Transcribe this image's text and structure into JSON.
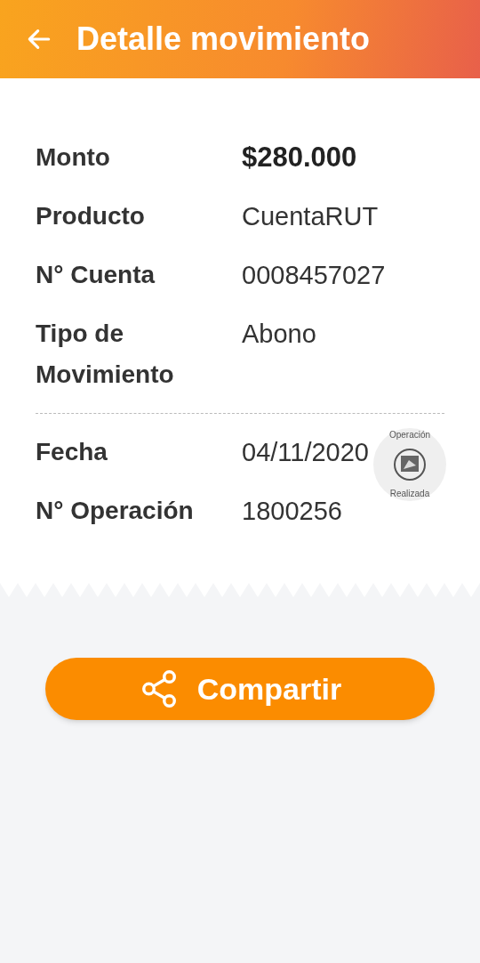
{
  "header": {
    "title": "Detalle movimiento"
  },
  "details": [
    {
      "label": "Monto",
      "value": "$280.000",
      "emphasis": true
    },
    {
      "label": "Producto",
      "value": "CuentaRUT",
      "emphasis": false
    },
    {
      "label": "N° Cuenta",
      "value": "0008457027",
      "emphasis": false
    },
    {
      "label": "Tipo de Movimiento",
      "value": "Abono",
      "emphasis": false
    }
  ],
  "details_2": [
    {
      "label": "Fecha",
      "value": "04/11/2020",
      "emphasis": false
    },
    {
      "label": "N° Operación",
      "value": "1800256",
      "emphasis": false
    }
  ],
  "stamp": {
    "top": "Operación",
    "bottom": "Realizada"
  },
  "share_button": {
    "label": "Compartir"
  }
}
